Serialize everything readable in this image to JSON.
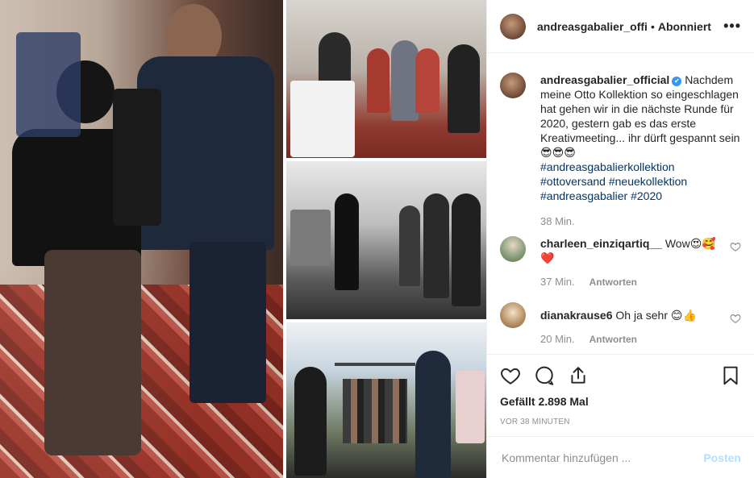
{
  "header": {
    "username": "andreasgabalier_offi",
    "separator": "•",
    "follow_status": "Abonniert",
    "more_label": "•••"
  },
  "caption": {
    "username": "andreasgabalier_official",
    "verified_mark": "✔",
    "text": "Nachdem meine Otto Kollektion so eingeschlagen hat gehen wir in die nächste Runde für 2020, gestern gab es das erste Kreativmeeting... ihr dürft gespannt sein😎😎😎",
    "hashtags": [
      "#andreasgabalierkollektion",
      "#ottoversand",
      "#neuekollektion",
      "#andreasgabalier",
      "#2020"
    ],
    "time": "38 Min."
  },
  "comments": [
    {
      "username": "charleen_einziqartiq__",
      "text": "Wow😍🥰❤️",
      "time": "37 Min.",
      "reply_label": "Antworten"
    },
    {
      "username": "dianakrause6",
      "text": "Oh ja sehr 😊👍",
      "time": "20 Min.",
      "reply_label": "Antworten"
    }
  ],
  "actions": {
    "likes": "Gefällt 2.898 Mal",
    "time_ago": "VOR 38 MINUTEN"
  },
  "compose": {
    "placeholder": "Kommentar hinzufügen ...",
    "post_label": "Posten"
  },
  "icons": {
    "like": "heart-icon",
    "comment": "comment-bubble-icon",
    "share": "share-icon",
    "save": "bookmark-icon"
  },
  "colors": {
    "link": "#003569",
    "verified": "#3897f0",
    "post_button_disabled": "#b2dffc",
    "muted_text": "#8e8e8e"
  }
}
